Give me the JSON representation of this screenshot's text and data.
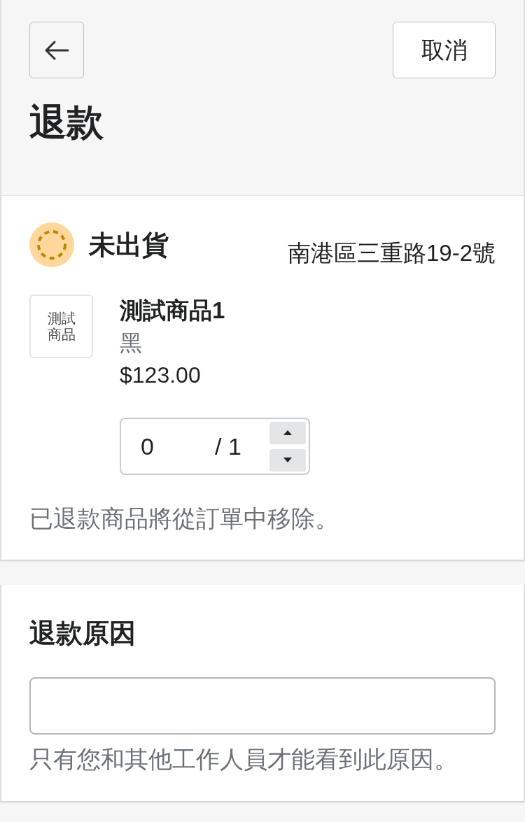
{
  "header": {
    "cancel_button": {
      "label": "取消"
    },
    "title": "退款"
  },
  "fulfillment_card": {
    "status": {
      "kind": "unfulfilled",
      "label": "未出貨"
    },
    "address": "南港區三重路19-2號",
    "items": [
      {
        "thumbnail_text": "測試商品",
        "name": "測試商品1",
        "variant": "黑",
        "price": "$123.00",
        "quantity": {
          "value": "0",
          "max": "/ 1"
        }
      }
    ],
    "note": "已退款商品將從訂單中移除。"
  },
  "reason_card": {
    "title": "退款原因",
    "help_text": "只有您和其他工作人員才能看到此原因。"
  }
}
